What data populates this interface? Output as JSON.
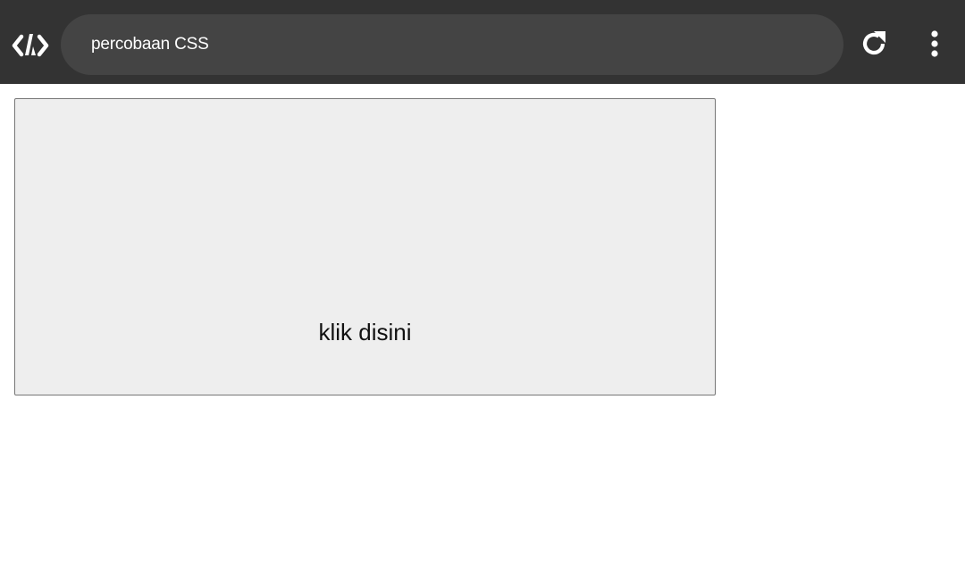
{
  "browser": {
    "logo_icon": "code-brackets-logo-icon",
    "address_text": "percobaan CSS",
    "reload_icon": "reload-icon",
    "menu_icon": "more-vert-icon",
    "colors": {
      "toolbar": "#333333",
      "address_bar": "#444444",
      "toolbar_text": "#ffffff"
    }
  },
  "page": {
    "button_label": "klik disini",
    "colors": {
      "button_background": "#eeeeee",
      "button_border": "#767676",
      "page_background": "#ffffff"
    }
  }
}
